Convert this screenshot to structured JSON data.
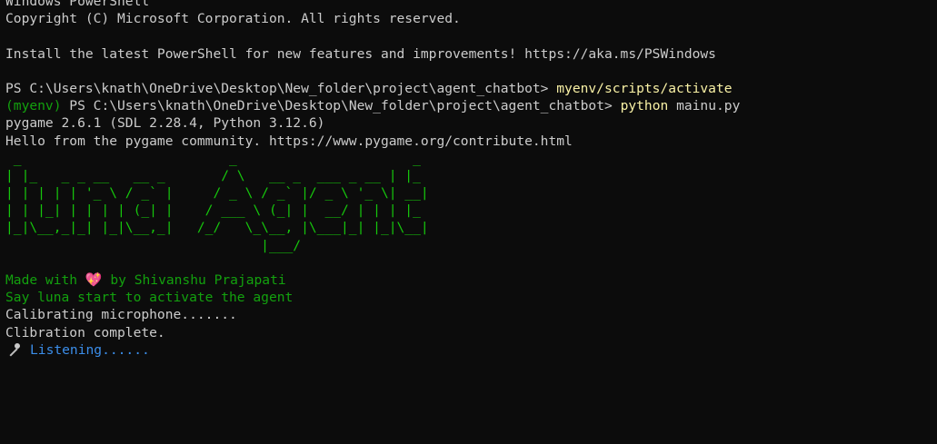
{
  "terminal": {
    "header_line_1": "Windows PowerShell",
    "header_line_2": "Copyright (C) Microsoft Corporation. All rights reserved.",
    "install_notice": "Install the latest PowerShell for new features and improvements! https://aka.ms/PSWindows",
    "prompt_1": "PS C:\\Users\\knath\\OneDrive\\Desktop\\New_folder\\project\\agent_chatbot> ",
    "command_1": "myenv/scripts/activate",
    "venv_tag": "(myenv)",
    "prompt_2": " PS C:\\Users\\knath\\OneDrive\\Desktop\\New_folder\\project\\agent_chatbot> ",
    "command_2_exe": "python",
    "command_2_arg": " mainu.py",
    "pygame_version": "pygame 2.6.1 (SDL 2.28.4, Python 3.12.6)",
    "pygame_hello": "Hello from the pygame community. https://www.pygame.org/contribute.html",
    "ascii_art": [
      " _                          _                      _",
      "| |_   _ _ __   __ _       / \\   __ _  ___ _ __ | |_",
      "| | | | | '_ \\ / _` |     / _ \\ / _` |/ _ \\ '_ \\| __|",
      "| | |_| | | | | (_| |    / ___ \\ (_| |  __/ | | | |_",
      "|_|\\__,_|_| |_|\\__,_|   /_/   \\_\\__, |\\___|_| |_|\\__|",
      "                                |___/"
    ],
    "made_with_prefix": "Made with ",
    "made_with_suffix": " by Shivanshu Prajapati",
    "activation_hint": "Say luna start to activate the agent",
    "calibrating": "Calibrating microphone.......",
    "calibration_done": "Clibration complete.",
    "listening": "Listening......"
  },
  "icons": {
    "heart": "sparkling-heart",
    "mic": "microphone"
  },
  "colors": {
    "background": "#0c0c0c",
    "text": "#cccccc",
    "command": "#f9f1a5",
    "green": "#13a10e",
    "ascii_green": "#16c60c",
    "listening_blue": "#3b8eea"
  }
}
